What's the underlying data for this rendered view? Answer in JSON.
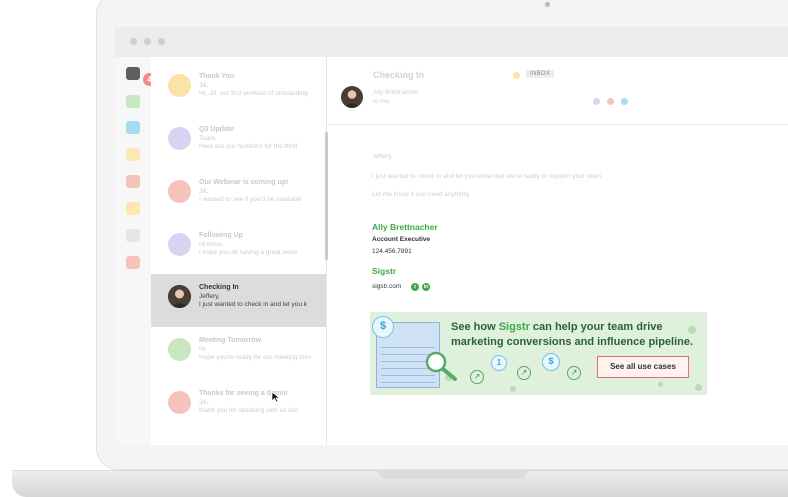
{
  "window": {
    "badge_count": "4"
  },
  "messages": [
    {
      "subject": "Thank You",
      "from": "Jill,",
      "preview": "Hi, Jill, our first workout of onboarding",
      "avatar_color": "#fbe3a6"
    },
    {
      "subject": "Q3 Update",
      "from": "Team,",
      "preview": "Here are our numbers for the third",
      "avatar_color": "#d9d2f0"
    },
    {
      "subject": "Our Webinar is coming up!",
      "from": "Jill,",
      "preview": "I wanted to see if you'd be available",
      "avatar_color": "#f6c2bc"
    },
    {
      "subject": "Following Up",
      "from": "Hi there,",
      "preview": "I hope you all having a great week",
      "avatar_color": "#d9d2f0"
    },
    {
      "subject": "Checking In",
      "from": "Jeffery,",
      "preview": "I just wanted to check in and let you k",
      "avatar_color": "photo",
      "active": true
    },
    {
      "subject": "Meeting Tomorrow",
      "from": "Hi",
      "preview": "Hope you're ready for our meeting tomo",
      "avatar_color": "#c8e6c0"
    },
    {
      "subject": "Thanks for seeing a demo!",
      "from": "Jill,",
      "preview": "thank you for speaking with us last",
      "avatar_color": "#f6c2bc"
    }
  ],
  "reader": {
    "subject": "Checking In",
    "tag": "INBOX",
    "from": "Ally Brettnacher",
    "to": "to me",
    "greeting": "Jeffery,",
    "body1": "I just wanted to check in and let you know that we're ready to support your team.",
    "body2": "Let me know if you need anything."
  },
  "signature": {
    "name": "Ally Brettnacher",
    "title": "Account Executive",
    "phone": "124.456.7891",
    "company": "Sigstr",
    "site": "sigstr.com"
  },
  "banner": {
    "headline_pre": "See how ",
    "brand": "Sigstr",
    "headline_post": " can help your team drive marketing conversions and influence pipeline.",
    "cta": "See all use cases"
  },
  "icons": {
    "rail": [
      "inbox-icon",
      "folder-green",
      "folder-blue",
      "folder-yellow",
      "folder-red",
      "folder-yellow",
      "folder-gray",
      "folder-red"
    ],
    "social": [
      "twitter-icon",
      "linkedin-icon"
    ]
  },
  "colors": {
    "brand_green": "#3ea84a",
    "cta_border": "#e36f6f",
    "banner_bg": "#dff0dd"
  }
}
